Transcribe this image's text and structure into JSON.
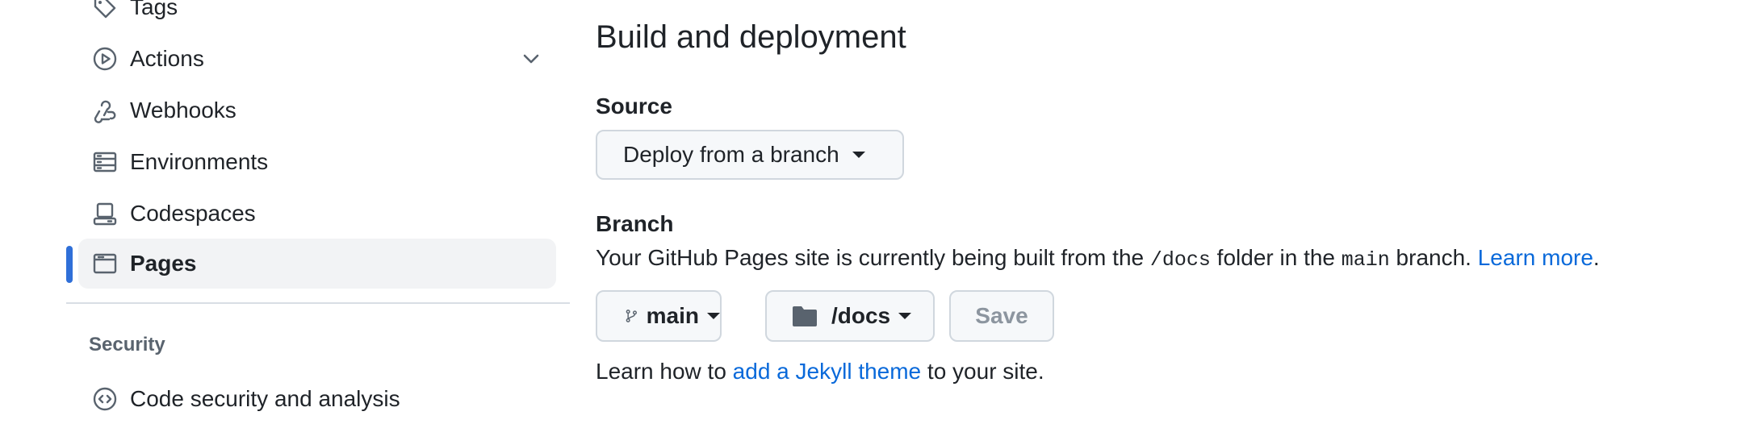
{
  "sidebar": {
    "items": [
      {
        "label": "Tags",
        "icon": "tag-icon"
      },
      {
        "label": "Actions",
        "icon": "play-circle-icon"
      },
      {
        "label": "Webhooks",
        "icon": "webhook-icon"
      },
      {
        "label": "Environments",
        "icon": "server-icon"
      },
      {
        "label": "Codespaces",
        "icon": "codespaces-icon"
      },
      {
        "label": "Pages",
        "icon": "browser-icon",
        "selected": true
      },
      {
        "label": "Code security and analysis",
        "icon": "codescan-icon"
      }
    ],
    "security_heading": "Security"
  },
  "main": {
    "title": "Build and deployment",
    "source_heading": "Source",
    "source_value": "Deploy from a branch",
    "branch_heading": "Branch",
    "description": {
      "prefix": "Your GitHub Pages site is currently being built from the ",
      "folder": "/docs",
      "middle": " folder in the ",
      "branch": "main",
      "suffix": " branch. ",
      "link": "Learn more",
      "end": "."
    },
    "branch_button": "main",
    "folder_button": "/docs",
    "save_button": "Save",
    "jekyll": {
      "prefix": "Learn how to ",
      "link": "add a Jekyll theme",
      "suffix": " to your site."
    }
  },
  "colors": {
    "accent": "#0969da",
    "selected_bar": "#2f6fd8",
    "selected_bg": "#f2f3f5",
    "text": "#1f2328",
    "muted": "#59636e"
  }
}
